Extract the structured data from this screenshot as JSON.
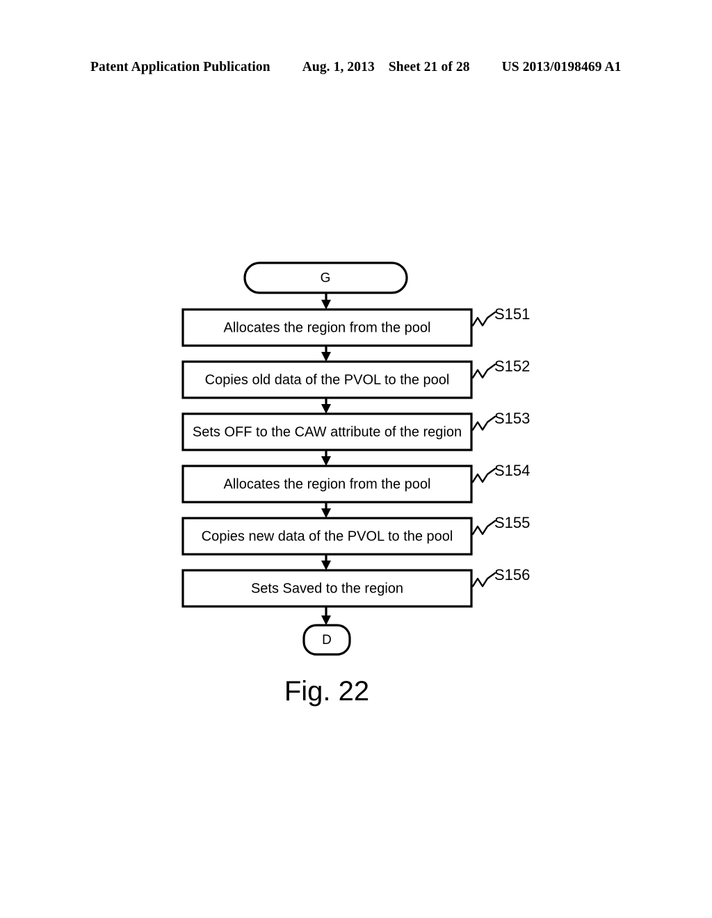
{
  "header": {
    "publication": "Patent Application Publication",
    "date": "Aug. 1, 2013",
    "sheet": "Sheet 21 of 28",
    "patent_number": "US 2013/0198469 A1"
  },
  "figure": {
    "caption": "Fig. 22",
    "start_terminator": "G",
    "end_terminator": "D",
    "steps": [
      {
        "ref": "S151",
        "text": "Allocates the region from the pool"
      },
      {
        "ref": "S152",
        "text": "Copies old data of the PVOL to the pool"
      },
      {
        "ref": "S153",
        "text": "Sets OFF to the CAW attribute of the region"
      },
      {
        "ref": "S154",
        "text": "Allocates the region from the pool"
      },
      {
        "ref": "S155",
        "text": "Copies new data of the PVOL to the pool"
      },
      {
        "ref": "S156",
        "text": "Sets Saved to the region"
      }
    ]
  }
}
